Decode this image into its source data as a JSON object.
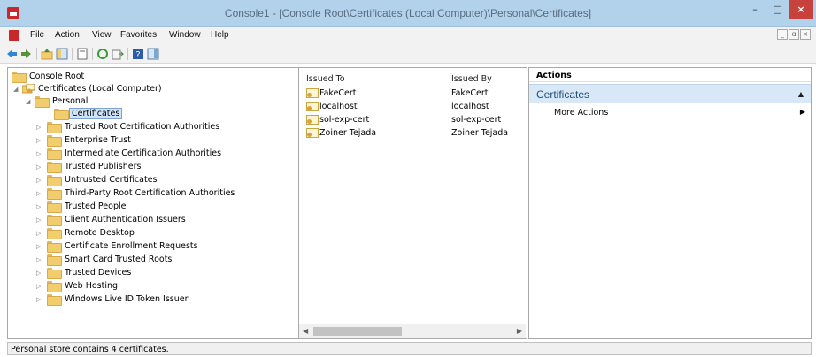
{
  "window": {
    "title": "Console1 - [Console Root\\Certificates (Local Computer)\\Personal\\Certificates]",
    "min": "–",
    "max": "□",
    "close": "×"
  },
  "menu": {
    "items": [
      "File",
      "Action",
      "View",
      "Favorites",
      "Window",
      "Help"
    ],
    "mdi": [
      "_",
      "ɑ",
      "×"
    ]
  },
  "toolbar": {
    "icons": [
      "back-arrow-icon",
      "forward-arrow-icon",
      "up-folder-icon",
      "show-hide-tree-icon",
      "properties-icon",
      "refresh-icon",
      "export-list-icon",
      "help-icon",
      "show-hide-action-pane-icon"
    ]
  },
  "tree": {
    "root": "Console Root",
    "computer": "Certificates (Local Computer)",
    "personal": "Personal",
    "certificates": "Certificates",
    "stores": [
      "Trusted Root Certification Authorities",
      "Enterprise Trust",
      "Intermediate Certification Authorities",
      "Trusted Publishers",
      "Untrusted Certificates",
      "Third-Party Root Certification Authorities",
      "Trusted People",
      "Client Authentication Issuers",
      "Remote Desktop",
      "Certificate Enrollment Requests",
      "Smart Card Trusted Roots",
      "Trusted Devices",
      "Web Hosting",
      "Windows Live ID Token Issuer"
    ]
  },
  "list": {
    "columns": [
      "Issued To",
      "Issued By"
    ],
    "rows": [
      {
        "issued_to": "FakeCert",
        "issued_by": "FakeCert"
      },
      {
        "issued_to": "localhost",
        "issued_by": "localhost"
      },
      {
        "issued_to": "sol-exp-cert",
        "issued_by": "sol-exp-cert"
      },
      {
        "issued_to": "Zoiner Tejada",
        "issued_by": "Zoiner Tejada"
      }
    ]
  },
  "actions": {
    "header": "Actions",
    "section": "Certificates",
    "more": "More Actions"
  },
  "status": {
    "text": "Personal store contains 4 certificates."
  },
  "colors": {
    "titlebar": "#b2d1ea",
    "close": "#c7423d",
    "folder": "#f2cd6d",
    "action_section": "#d9e8f6"
  }
}
